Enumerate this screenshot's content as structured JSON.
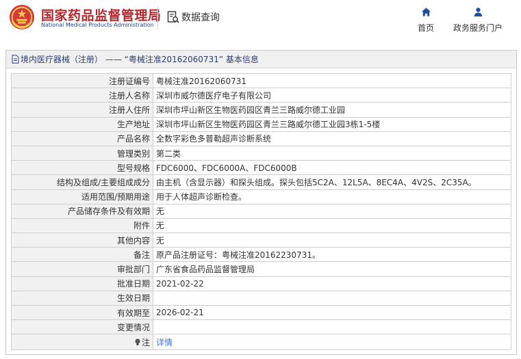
{
  "header": {
    "site_name_cn": "国家药品监督管理局",
    "site_name_en": "National Medical Products Administration",
    "query_label": "数据查询",
    "nav": [
      {
        "label": "首页"
      },
      {
        "label": "政务服务门户"
      }
    ]
  },
  "panel": {
    "title": "境内医疗器械（注册） —— “粤械注准20162060731” 基本信息"
  },
  "rows": [
    {
      "key": "注册证编号",
      "value": "粤械注准20162060731"
    },
    {
      "key": "注册人名称",
      "value": "深圳市威尔德医疗电子有限公司"
    },
    {
      "key": "注册人住所",
      "value": "深圳市坪山新区生物医药园区青兰三路威尔德工业园"
    },
    {
      "key": "生产地址",
      "value": "深圳市坪山新区生物医药园区青兰三路威尔德工业园3栋1-5楼"
    },
    {
      "key": "产品名称",
      "value": "全数字彩色多普勒超声诊断系统"
    },
    {
      "key": "管理类别",
      "value": "第二类"
    },
    {
      "key": "型号规格",
      "value": "FDC6000、FDC6000A、FDC6000B"
    },
    {
      "key": "结构及组成/主要组成成分",
      "value": "由主机（含显示器）和探头组成。探头包括5C2A、12L5A、8EC4A、4V2S、2C35A。"
    },
    {
      "key": "适用范围/预期用途",
      "value": "用于人体超声诊断检查。"
    },
    {
      "key": "产品储存条件及有效期",
      "value": "无"
    },
    {
      "key": "附件",
      "value": "无"
    },
    {
      "key": "其他内容",
      "value": "无"
    },
    {
      "key": "备注",
      "value": "原产品注册证号：粤械注准20162230731。"
    },
    {
      "key": "审批部门",
      "value": "广东省食品药品监督管理局"
    },
    {
      "key": "批准日期",
      "value": "2021-02-22"
    },
    {
      "key": "生效日期",
      "value": ""
    },
    {
      "key": "有效期至",
      "value": "2026-02-21"
    },
    {
      "key": "变更情况",
      "value": ""
    }
  ],
  "note": {
    "key": "注",
    "link_label": "详情"
  },
  "colors": {
    "brand_red": "#b4282d",
    "brand_blue": "#1f3f8a",
    "nav_icon": "#1e4fa0",
    "link": "#3f6fd0"
  }
}
